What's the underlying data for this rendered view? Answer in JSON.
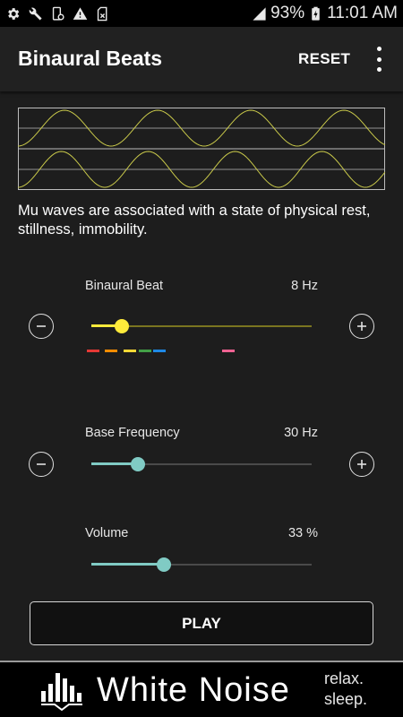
{
  "status_bar": {
    "icons": [
      "settings-icon",
      "wrench-icon",
      "phone-settings-icon",
      "warning-icon",
      "sd-card-icon",
      "signal-icon",
      "battery-icon"
    ],
    "battery": "93%",
    "time": "11:01 AM"
  },
  "app_bar": {
    "title": "Binaural Beats",
    "reset_label": "RESET",
    "more_icon": "more-vert-icon"
  },
  "waveform": {
    "color": "#c9c94a",
    "frame_color": "#bdbdbd"
  },
  "description": "Mu waves are associated with a state of physical rest, stillness, immobility.",
  "binaural_beat": {
    "label": "Binaural Beat",
    "value": "8 Hz",
    "level": 0.14,
    "accent": "#ffeb3b",
    "band_colors": [
      "#e53935",
      "#fb8c00",
      "#fdd835",
      "#43a047",
      "#1e88e5",
      "#f06292"
    ]
  },
  "base_frequency": {
    "label": "Base Frequency",
    "value": "30 Hz",
    "level": 0.21,
    "accent": "#80cbc4"
  },
  "volume": {
    "label": "Volume",
    "value": "33 %",
    "level": 0.33,
    "accent": "#80cbc4"
  },
  "play_label": "PLAY",
  "footer": {
    "brand": "White Noise",
    "tagline_1": "relax.",
    "tagline_2": "sleep."
  }
}
